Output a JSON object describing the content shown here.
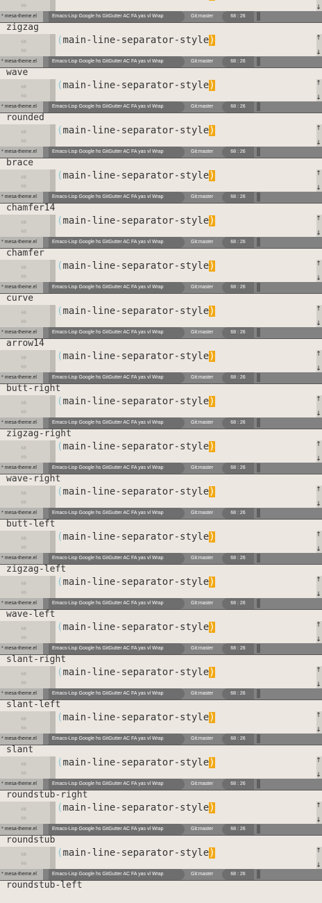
{
  "editor": {
    "line_a": "68",
    "line_b": "69",
    "code_open_paren": "(",
    "code_text": "main-line-separator-style",
    "code_cursor_char": ")",
    "scroll_up": "↑",
    "scroll_down": "↓"
  },
  "modeline": {
    "file": "* mesa-theme.el",
    "modes": "Emacs-Lisp Google hs GitGutter AC FA yas vl Wrap",
    "git": "Git:master",
    "position": "68 : 26"
  },
  "styles": [
    "zigzag",
    "wave",
    "rounded",
    "brace",
    "chamfer14",
    "chamfer",
    "curve",
    "arrow14",
    "butt-right",
    "zigzag-right",
    "wave-right",
    "butt-left",
    "zigzag-left",
    "wave-left",
    "slant-right",
    "slant-left",
    "slant",
    "roundstub-right",
    "roundstub",
    "roundstub-left"
  ]
}
